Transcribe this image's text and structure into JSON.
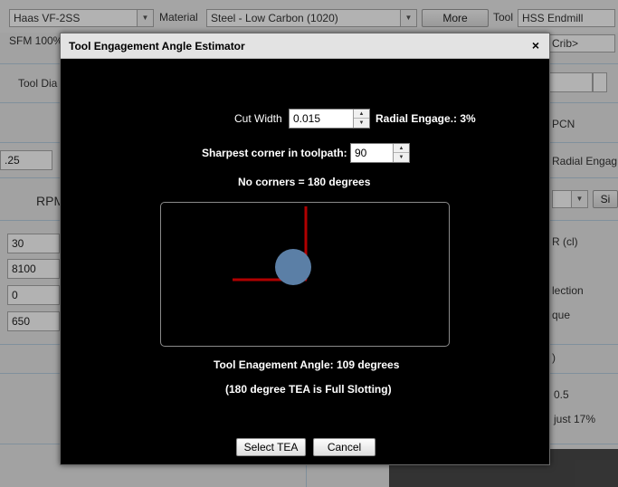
{
  "background": {
    "machine_select": "Haas VF-2SS",
    "material_label": "Material",
    "material_select": "Steel - Low Carbon (1020)",
    "more_button": "More",
    "tool_label": "Tool",
    "tool_select": "HSS Endmill",
    "sfm_text": "SFM 100%",
    "crib_select": "Crib>",
    "tool_dia_label": "Tool Dia",
    "pcn_label": "PCN",
    "value_25": ".25",
    "radial_engag_label": "Radial Engag",
    "rpm_label": "RPM",
    "si_button": "Si",
    "input_values": [
      "30",
      "8100",
      "0",
      "650"
    ],
    "r_cl_label": "R (cl)",
    "lection_label": "lection",
    "que_label": "que",
    "paren_label": ")",
    "val_05": "0.5",
    "just_label": "just 17%"
  },
  "dialog": {
    "title": "Tool Engagement Angle Estimator",
    "close_symbol": "×",
    "cut_width_label": "Cut Width",
    "cut_width_value": "0.015",
    "radial_engage_text": "Radial Engage.: 3%",
    "sharpest_corner_label": "Sharpest corner in toolpath:",
    "sharpest_corner_value": "90",
    "no_corners_text": "No corners = 180 degrees",
    "tea_text": "Tool Enagement Angle: 109 degrees",
    "slotting_note": "(180 degree TEA is Full Slotting)",
    "select_button": "Select TEA",
    "cancel_button": "Cancel",
    "colors": {
      "toolpath": "#b00000",
      "tool": "#5b7fa6"
    }
  }
}
